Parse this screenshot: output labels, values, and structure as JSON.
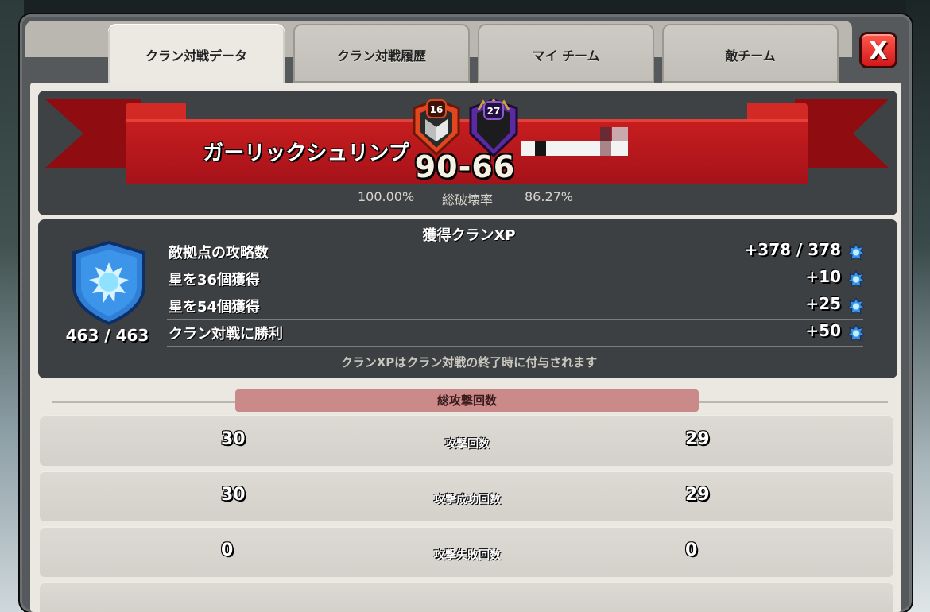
{
  "tabs": [
    {
      "label": "クラン対戦データ",
      "active": true
    },
    {
      "label": "クラン対戦履歴",
      "active": false
    },
    {
      "label": "マイ チーム",
      "active": false
    },
    {
      "label": "敵チーム",
      "active": false
    }
  ],
  "close_label": "X",
  "header": {
    "clan_name": "ガーリックシュリンプ",
    "score": "90-66",
    "left_badge_level": "16",
    "right_badge_level": "27",
    "left_destruction": "100.00%",
    "destruction_label": "総破壊率",
    "right_destruction": "86.27%"
  },
  "xp": {
    "title": "獲得クランXP",
    "total": "463 / 463",
    "rows": [
      {
        "label": "敵拠点の攻略数",
        "value": "+378 / 378"
      },
      {
        "label": "星を36個獲得",
        "value": "+10"
      },
      {
        "label": "星を54個獲得",
        "value": "+25"
      },
      {
        "label": "クラン対戦に勝利",
        "value": "+50"
      }
    ],
    "note": "クランXPはクラン対戦の終了時に付与されます"
  },
  "stats": {
    "section_title": "総攻撃回数",
    "rows": [
      {
        "left": "30",
        "label": "攻撃回数",
        "right": "29"
      },
      {
        "left": "30",
        "label": "攻撃成功回数",
        "right": "29"
      },
      {
        "left": "0",
        "label": "攻撃失敗回数",
        "right": "0"
      }
    ]
  },
  "colors": {
    "ribbon_red": "#c81e1f",
    "close_red": "#d4171a",
    "xp_blue": "#2f7fd6",
    "section_pill": "#c98a89"
  },
  "icons": {
    "close": "close-icon",
    "xp": "clan-xp-icon",
    "shield": "clan-xp-shield-icon",
    "left_badge": "clan-badge-icon",
    "right_badge": "enemy-clan-badge-icon"
  }
}
